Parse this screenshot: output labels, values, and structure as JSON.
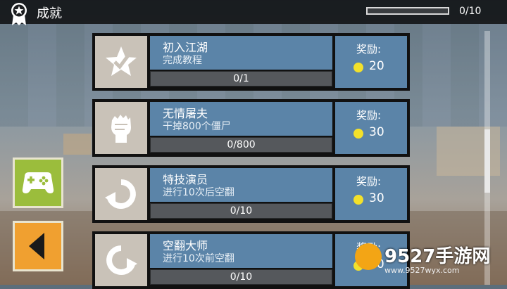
{
  "header": {
    "title": "成就",
    "progress_text": "0/10",
    "progress_fraction": 0
  },
  "sidebar": {
    "games_icon": "gamepad-icon",
    "back_icon": "triangle-left-icon"
  },
  "achievements": [
    {
      "name": "初入江湖",
      "desc": "完成教程",
      "progress": "0/1",
      "reward_label": "奖励:",
      "reward": "20",
      "icon": "star-check-icon"
    },
    {
      "name": "无情屠夫",
      "desc": "干掉800个僵尸",
      "progress": "0/800",
      "reward_label": "奖励:",
      "reward": "30",
      "icon": "zombie-fist-icon"
    },
    {
      "name": "特技演员",
      "desc": "进行10次后空翻",
      "progress": "0/10",
      "reward_label": "奖励:",
      "reward": "30",
      "icon": "backflip-icon"
    },
    {
      "name": "空翻大师",
      "desc": "进行10次前空翻",
      "progress": "0/10",
      "reward_label": "奖励:",
      "reward": "30",
      "icon": "frontflip-icon"
    }
  ],
  "watermark": {
    "main": "9527手游网",
    "sub": "www.9527wyx.com"
  },
  "colors": {
    "card_blue": "#5b84a8",
    "coin": "#f3e12b",
    "games_button": "#9bbd3c",
    "back_button": "#f0a030"
  }
}
